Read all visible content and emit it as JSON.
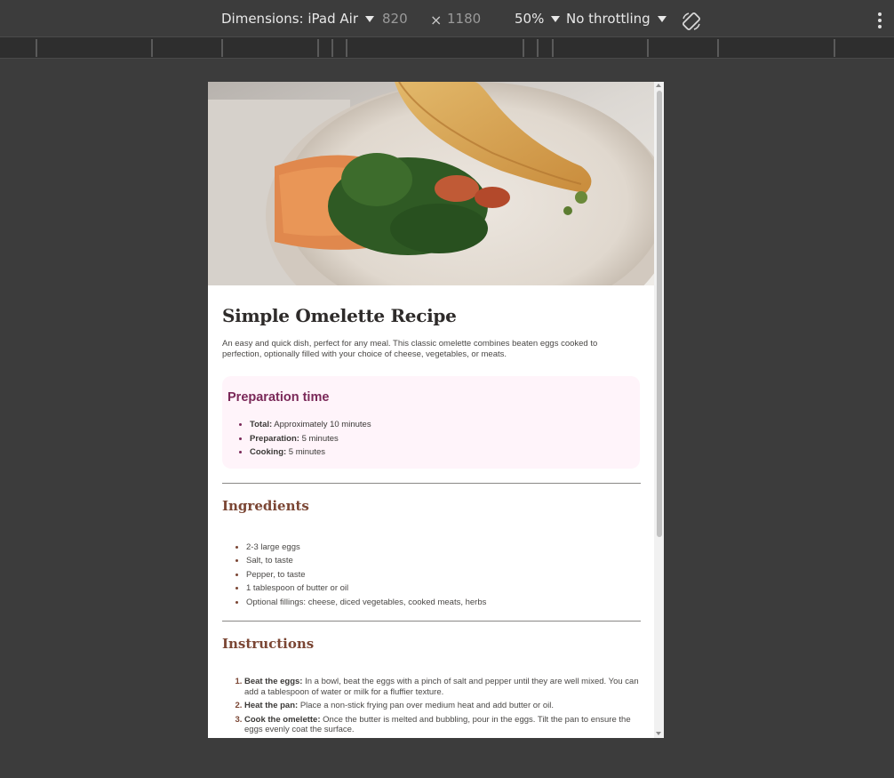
{
  "devtools": {
    "dimensions_label": "Dimensions: iPad Air",
    "width": "820",
    "times": "×",
    "height": "1180",
    "zoom": "50%",
    "throttling": "No throttling"
  },
  "recipe": {
    "title": "Simple Omelette Recipe",
    "intro": "An easy and quick dish, perfect for any meal. This classic omelette combines beaten eggs cooked to perfection, optionally filled with your choice of cheese, vegetables, or meats.",
    "prep": {
      "heading": "Preparation time",
      "items": [
        {
          "label": "Total:",
          "value": " Approximately 10 minutes"
        },
        {
          "label": "Preparation:",
          "value": " 5 minutes"
        },
        {
          "label": "Cooking:",
          "value": " 5 minutes"
        }
      ]
    },
    "ingredients": {
      "heading": "Ingredients",
      "items": [
        "2-3 large eggs",
        "Salt, to taste",
        "Pepper, to taste",
        "1 tablespoon of butter or oil",
        "Optional fillings: cheese, diced vegetables, cooked meats, herbs"
      ]
    },
    "instructions": {
      "heading": "Instructions",
      "items": [
        {
          "label": "Beat the eggs:",
          "value": " In a bowl, beat the eggs with a pinch of salt and pepper until they are well mixed. You can add a tablespoon of water or milk for a fluffier texture."
        },
        {
          "label": "Heat the pan:",
          "value": " Place a non-stick frying pan over medium heat and add butter or oil."
        },
        {
          "label": "Cook the omelette:",
          "value": " Once the butter is melted and bubbling, pour in the eggs. Tilt the pan to ensure the eggs evenly coat the surface."
        }
      ]
    }
  },
  "colors": {
    "nutmeg": "#7b4634",
    "raspberry": "#7a2858",
    "rose_white": "#fff4fa",
    "dark": "#2e2b2a"
  }
}
